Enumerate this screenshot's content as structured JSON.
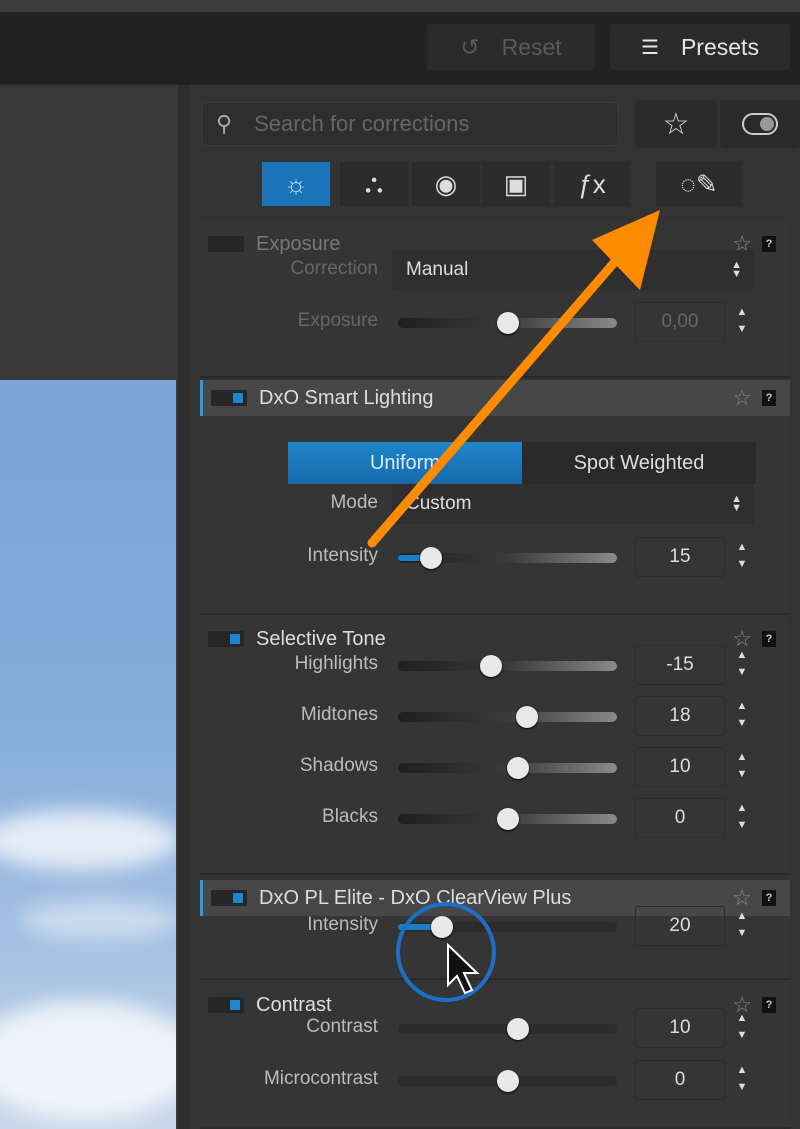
{
  "toolbar": {
    "reset_label": "Reset",
    "presets_label": "Presets"
  },
  "search": {
    "placeholder": "Search for corrections"
  },
  "tabs": [
    {
      "icon": "sun-icon",
      "glyph": "☼",
      "active": true
    },
    {
      "icon": "color-circles-icon",
      "glyph": "⛬"
    },
    {
      "icon": "lens-icon",
      "glyph": "◉"
    },
    {
      "icon": "cube-icon",
      "glyph": "▣"
    },
    {
      "icon": "fx-icon",
      "glyph": "ƒx"
    }
  ],
  "local_adjustments_icon": "brush-icon",
  "accent_color": "#1a74b8",
  "annotation_color": "#ff8c00",
  "sections": [
    {
      "title": "Exposure",
      "enabled": false,
      "dim": true,
      "highlighted": false,
      "rows": [
        {
          "type": "select",
          "label": "Correction",
          "value": "Manual"
        },
        {
          "type": "slider",
          "label": "Exposure",
          "value": "0,00",
          "fraction": 0.5,
          "centered": true
        }
      ]
    },
    {
      "title": "DxO Smart Lighting",
      "enabled": true,
      "highlighted": true,
      "segmented": {
        "options": [
          "Uniform",
          "Spot Weighted"
        ],
        "selected": 0
      },
      "rows": [
        {
          "type": "select",
          "label": "Mode",
          "value": "Custom"
        },
        {
          "type": "slider",
          "label": "Intensity",
          "value": "15",
          "fraction": 0.15,
          "centered": false
        }
      ]
    },
    {
      "title": "Selective Tone",
      "enabled": true,
      "highlighted": false,
      "rows": [
        {
          "type": "slider",
          "label": "Highlights",
          "value": "-15",
          "fraction": 0.425,
          "centered": true
        },
        {
          "type": "slider",
          "label": "Midtones",
          "value": "18",
          "fraction": 0.59,
          "centered": true
        },
        {
          "type": "slider",
          "label": "Shadows",
          "value": "10",
          "fraction": 0.55,
          "centered": true
        },
        {
          "type": "slider",
          "label": "Blacks",
          "value": "0",
          "fraction": 0.5,
          "centered": true
        }
      ]
    },
    {
      "title": "DxO PL Elite - DxO ClearView Plus",
      "enabled": true,
      "highlighted": true,
      "rows": [
        {
          "type": "slider",
          "label": "Intensity",
          "value": "20",
          "fraction": 0.2,
          "centered": false,
          "plain": true
        }
      ]
    },
    {
      "title": "Contrast",
      "enabled": true,
      "highlighted": false,
      "rows": [
        {
          "type": "slider",
          "label": "Contrast",
          "value": "10",
          "fraction": 0.55,
          "centered": true,
          "plain": true
        },
        {
          "type": "slider",
          "label": "Microcontrast",
          "value": "0",
          "fraction": 0.5,
          "centered": true,
          "plain": true
        }
      ]
    }
  ]
}
